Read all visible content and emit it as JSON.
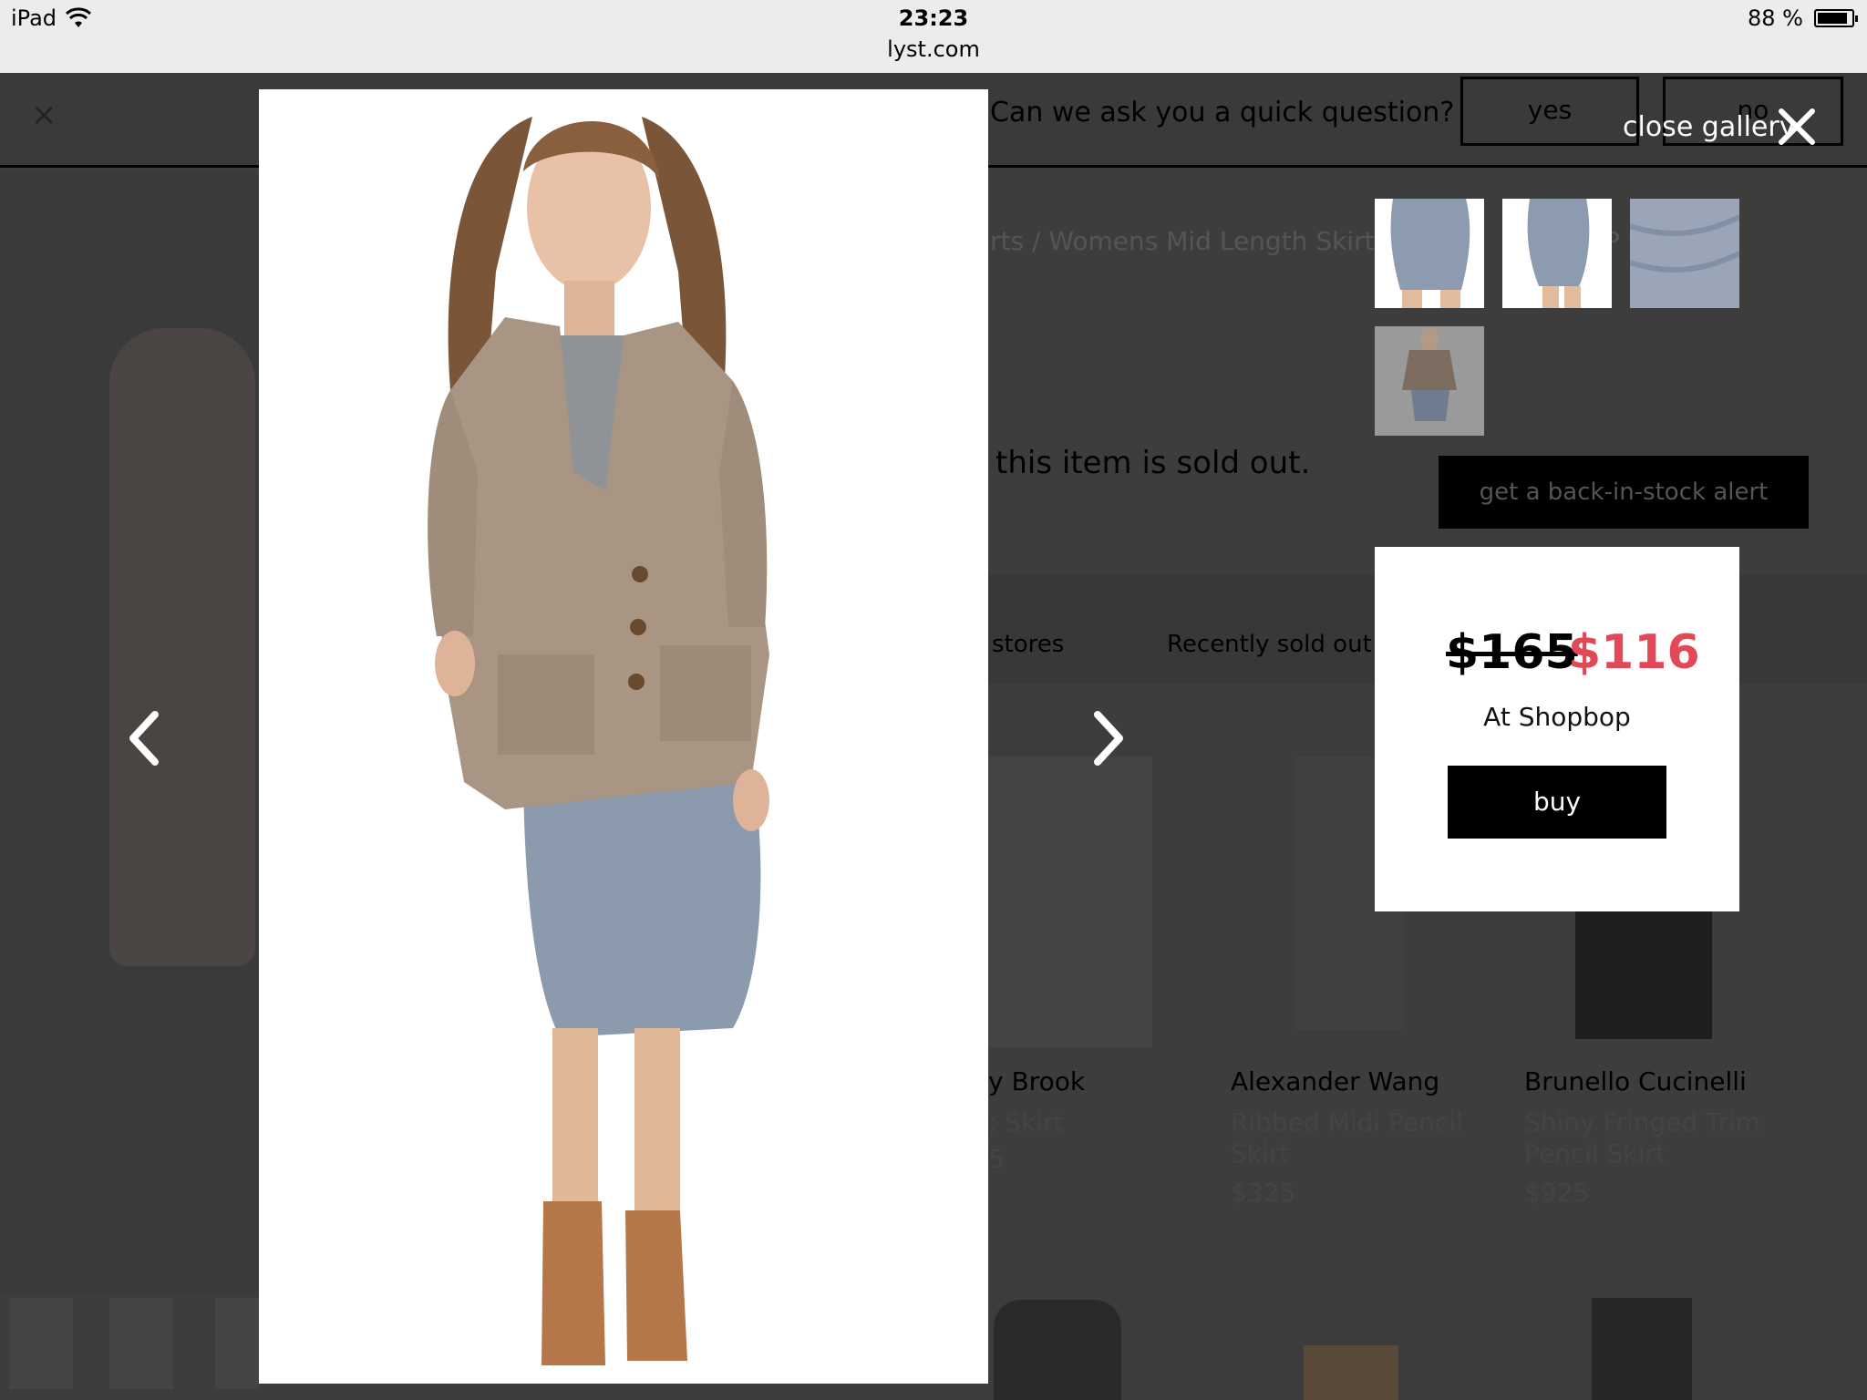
{
  "status_bar": {
    "device": "iPad",
    "time": "23:23",
    "url": "lyst.com",
    "battery_text": "88 %",
    "battery_level": 0.88
  },
  "survey": {
    "close_glyph": "×",
    "question": "Can we ask you a quick question?",
    "yes_label": "yes",
    "no_label": "no"
  },
  "page": {
    "breadcrumb": "rts / Womens Mid Length Skirts",
    "breadcrumb_tail": "P        s",
    "sold_out_text": "this item is sold out.",
    "alert_button": "get a back-in-stock alert",
    "tabs": {
      "stores": "stores",
      "recently_sold_out": "Recently sold out"
    },
    "products": [
      {
        "brand": "y Brook",
        "name": "; Skirt",
        "price": "5"
      },
      {
        "brand": "Alexander Wang",
        "name": "Ribbed Midi Pencil Skirt",
        "price": "$325"
      },
      {
        "brand": "Brunello Cucinelli",
        "name": "Shiny Fringed Trim Pencil Skirt",
        "price": "$925"
      }
    ]
  },
  "gallery": {
    "close_label": "close gallery",
    "close_icon": "close-x-icon",
    "prev_icon": "chevron-left-icon",
    "next_icon": "chevron-right-icon",
    "thumbnail_count": 4
  },
  "price_card": {
    "original_price": "$165",
    "sale_price": "$116",
    "retailer": "At Shopbop",
    "buy_label": "buy",
    "sale_color": "#e24858"
  }
}
